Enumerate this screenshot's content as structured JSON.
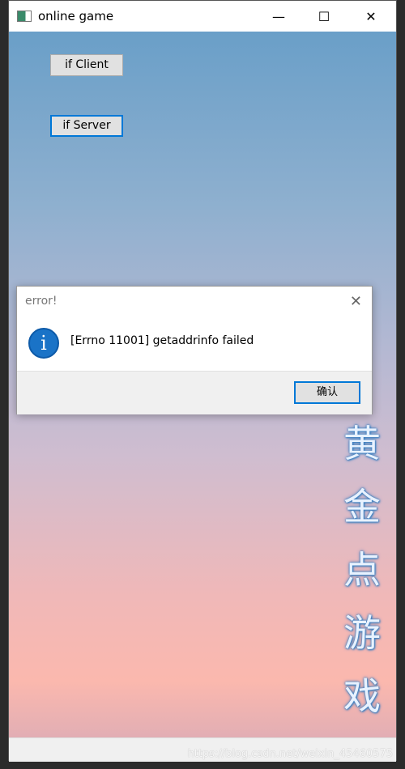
{
  "window": {
    "title": "online game",
    "minimize": "—",
    "maximize": "☐",
    "close": "✕"
  },
  "buttons": {
    "client": "if Client",
    "server": "if Server"
  },
  "vertical_title": [
    "黄",
    "金",
    "点",
    "游",
    "戏"
  ],
  "watermark": "https://blog.csdn.net/weixin_45460575",
  "dialog": {
    "title": "error!",
    "close": "✕",
    "icon": "info-icon",
    "icon_glyph": "i",
    "message": "[Errno 11001] getaddrinfo failed",
    "ok": "确认"
  },
  "colors": {
    "accent": "#0078d7",
    "info": "#1a73c7"
  }
}
